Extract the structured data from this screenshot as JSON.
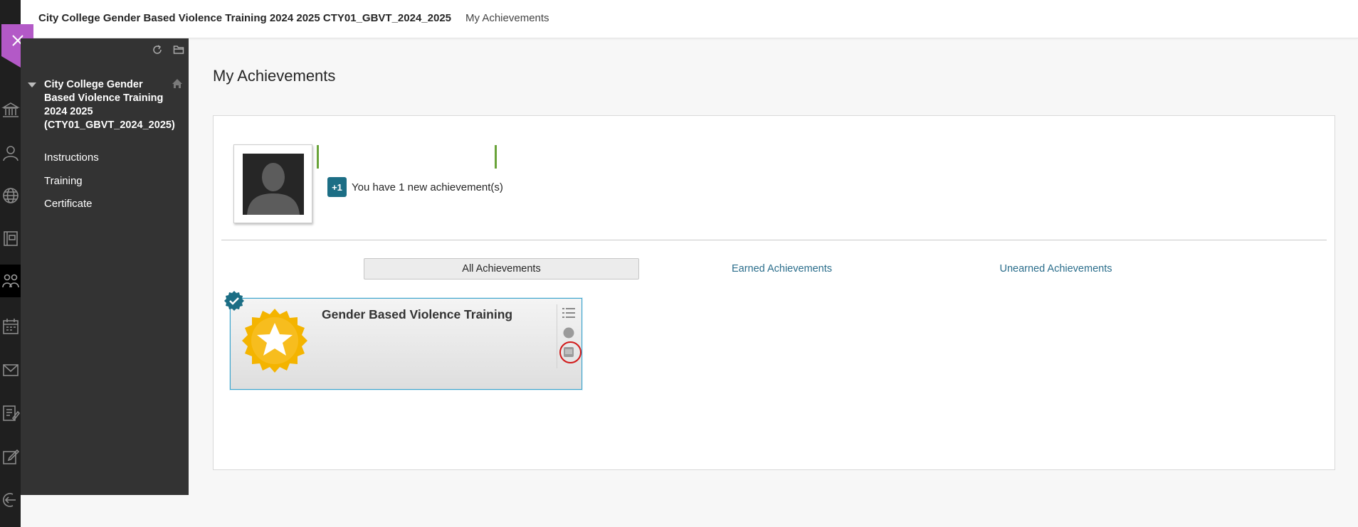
{
  "topbar": {
    "course_title": "City College Gender Based Violence Training 2024 2025 CTY01_GBVT_2024_2025",
    "breadcrumb": "My Achievements"
  },
  "course_menu": {
    "heading": "City College Gender Based Violence Training 2024 2025 (CTY01_GBVT_2024_2025)",
    "items": [
      {
        "label": "Instructions"
      },
      {
        "label": "Training"
      },
      {
        "label": "Certificate"
      }
    ]
  },
  "main": {
    "title": "My Achievements",
    "new_badge": "+1",
    "new_text": "You have 1 new achievement(s)",
    "tabs": [
      {
        "label": "All Achievements",
        "active": true
      },
      {
        "label": "Earned Achievements",
        "active": false
      },
      {
        "label": "Unearned Achievements",
        "active": false
      }
    ],
    "achievement": {
      "title": "Gender Based Violence Training",
      "earned": true
    }
  },
  "colors": {
    "accent_purple": "#b359c7",
    "badge_teal": "#1c6e85",
    "link_blue": "#2a6d8b",
    "menu_dark": "#333333",
    "rail_dark": "#1f1f1f",
    "progress_green": "#69a339",
    "annotation_red": "#d11a1a",
    "badge_gold": "#f4b400"
  },
  "icons": {
    "rail": [
      "institution-icon",
      "profile-icon",
      "globe-icon",
      "courses-icon",
      "organizations-icon",
      "calendar-icon",
      "messages-icon",
      "grades-icon",
      "tools-icon",
      "sign-out-icon"
    ],
    "menu_tools": [
      "refresh-icon",
      "folder-icon"
    ],
    "card_tools": [
      "list-icon",
      "circle-icon",
      "badge-icon"
    ]
  }
}
